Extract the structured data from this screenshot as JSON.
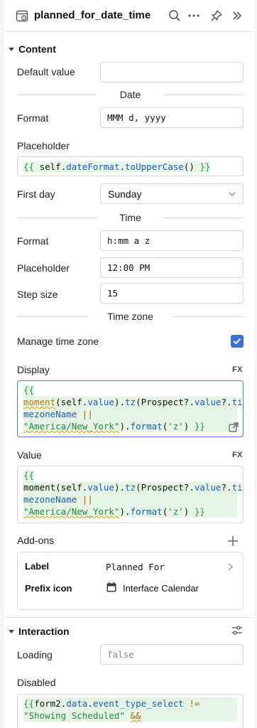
{
  "header": {
    "title": "planned_for_date_time",
    "icons": [
      "date-component-icon",
      "search-icon",
      "more-icon",
      "pin-icon",
      "collapse-icon"
    ]
  },
  "content": {
    "section_label": "Content",
    "default_value": {
      "label": "Default value",
      "value": ""
    },
    "date_divider": "Date",
    "date_format": {
      "label": "Format",
      "value": "MMM d, yyyy"
    },
    "date_placeholder": {
      "label": "Placeholder"
    },
    "first_day": {
      "label": "First day",
      "value": "Sunday"
    },
    "time_divider": "Time",
    "time_format": {
      "label": "Format",
      "value": "h:mm a z"
    },
    "time_placeholder": {
      "label": "Placeholder",
      "value": "12:00 PM"
    },
    "step_size": {
      "label": "Step size",
      "value": "15"
    },
    "timezone_divider": "Time zone",
    "manage_tz": {
      "label": "Manage time zone",
      "checked": true
    },
    "display": {
      "label": "Display",
      "fx": "FX"
    },
    "value": {
      "label": "Value",
      "fx": "FX"
    },
    "addons": {
      "label": "Add-ons",
      "items": [
        {
          "label": "Label",
          "value": "Planned For"
        },
        {
          "label": "Prefix icon",
          "value": "Interface Calendar"
        }
      ]
    }
  },
  "interaction": {
    "section_label": "Interaction",
    "loading": {
      "label": "Loading",
      "value": "false"
    },
    "disabled": {
      "label": "Disabled"
    }
  },
  "colors": {
    "accent": "#3b6fd4",
    "string": "#1f8a3a",
    "property": "#1e5bb8"
  }
}
